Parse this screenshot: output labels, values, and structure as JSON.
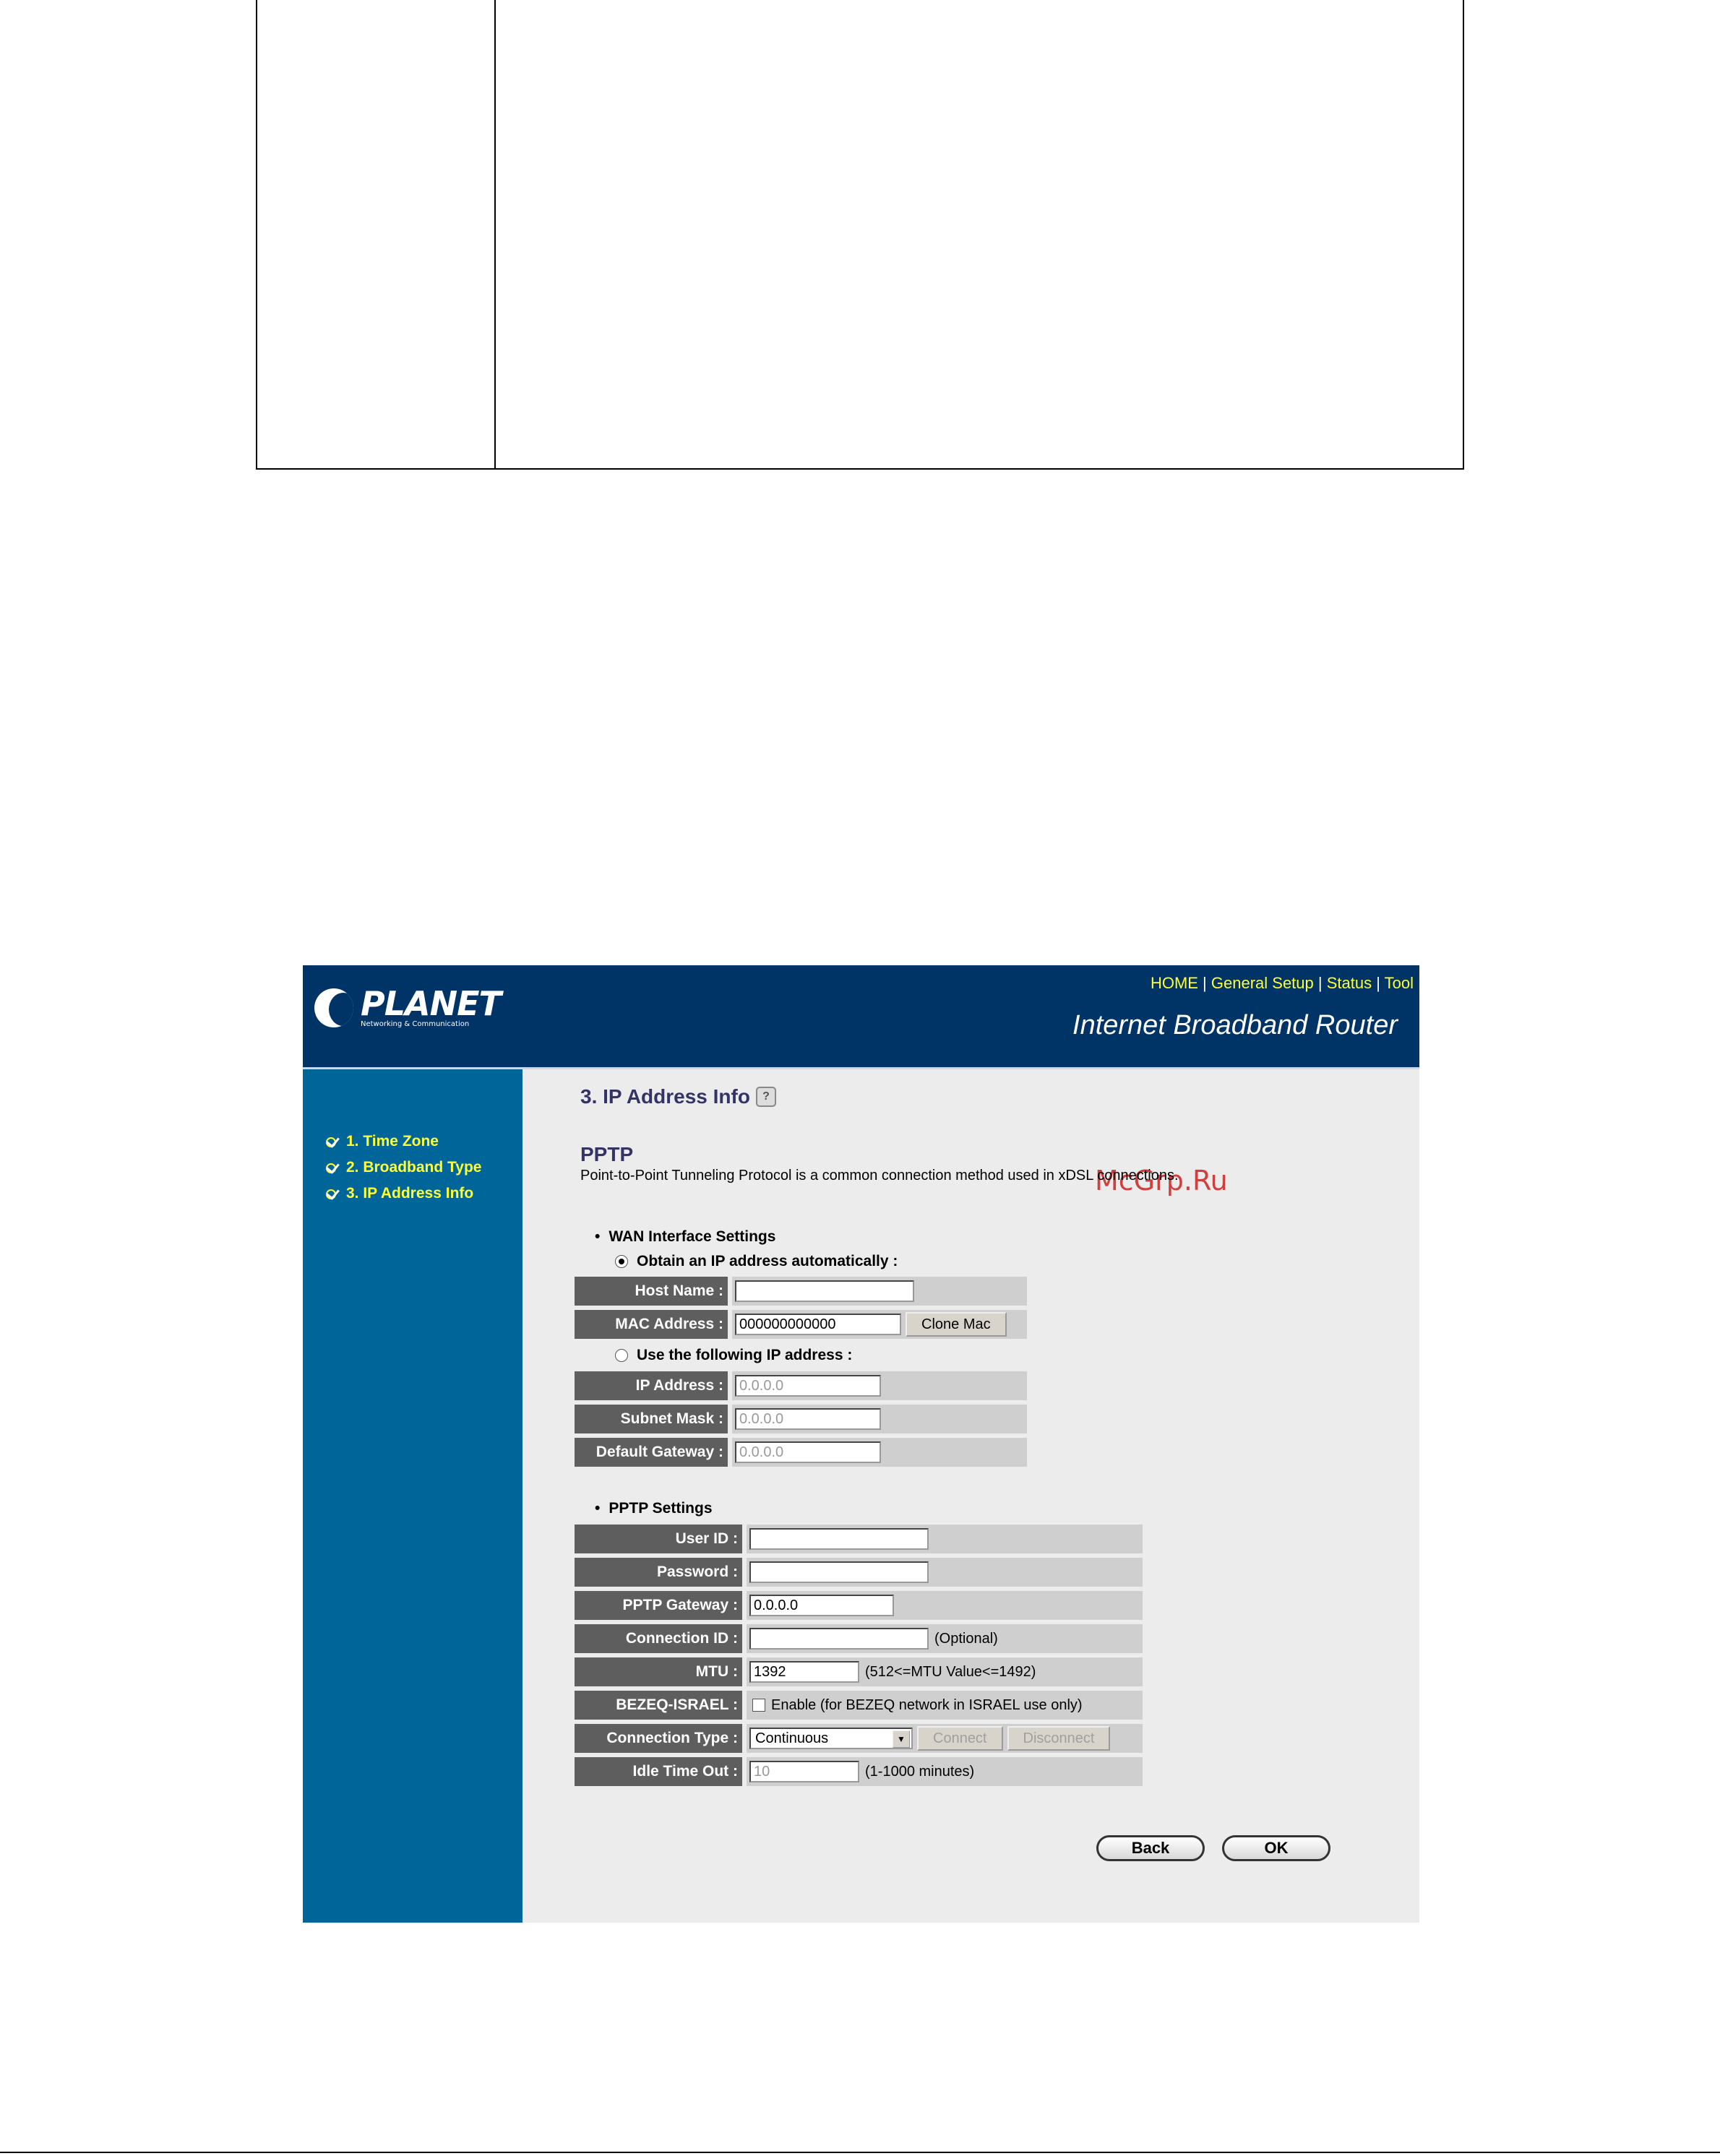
{
  "header": {
    "logo_text": "PLANET",
    "logo_tagline": "Networking & Communication",
    "nav": [
      "HOME",
      "General Setup",
      "Status",
      "Tool"
    ],
    "router_title": "Internet Broadband Router"
  },
  "sidebar": {
    "steps": [
      "1. Time Zone",
      "2. Broadband Type",
      "3. IP Address Info"
    ]
  },
  "main": {
    "page_title": "3. IP Address Info",
    "watermark": "McGrp.Ru",
    "protocol_title": "PPTP",
    "protocol_desc": "Point-to-Point Tunneling Protocol is a common connection method used in xDSL connections.",
    "wan": {
      "heading": "WAN Interface Settings",
      "obtain_auto": "Obtain an IP address automatically :",
      "host_name_label": "Host Name :",
      "host_name_value": "",
      "mac_label": "MAC Address :",
      "mac_value": "000000000000",
      "clone_mac": "Clone Mac",
      "use_following": "Use the following IP address :",
      "ip_label": "IP Address :",
      "ip_value": "0.0.0.0",
      "subnet_label": "Subnet Mask :",
      "subnet_value": "0.0.0.0",
      "gateway_label": "Default Gateway :",
      "gateway_value": "0.0.0.0"
    },
    "pptp": {
      "heading": "PPTP Settings",
      "user_id_label": "User ID :",
      "user_id_value": "",
      "password_label": "Password :",
      "password_value": "",
      "gateway_label": "PPTP Gateway :",
      "gateway_value": "0.0.0.0",
      "conn_id_label": "Connection ID :",
      "conn_id_value": "",
      "conn_id_hint": "(Optional)",
      "mtu_label": "MTU :",
      "mtu_value": "1392",
      "mtu_hint": "(512<=MTU Value<=1492)",
      "bezeq_label": "BEZEQ-ISRAEL :",
      "bezeq_hint": "Enable (for BEZEQ network in ISRAEL use only)",
      "conn_type_label": "Connection Type :",
      "conn_type_value": "Continuous",
      "connect": "Connect",
      "disconnect": "Disconnect",
      "idle_label": "Idle Time Out :",
      "idle_value": "10",
      "idle_hint": "(1-1000 minutes)"
    },
    "back": "Back",
    "ok": "OK"
  }
}
